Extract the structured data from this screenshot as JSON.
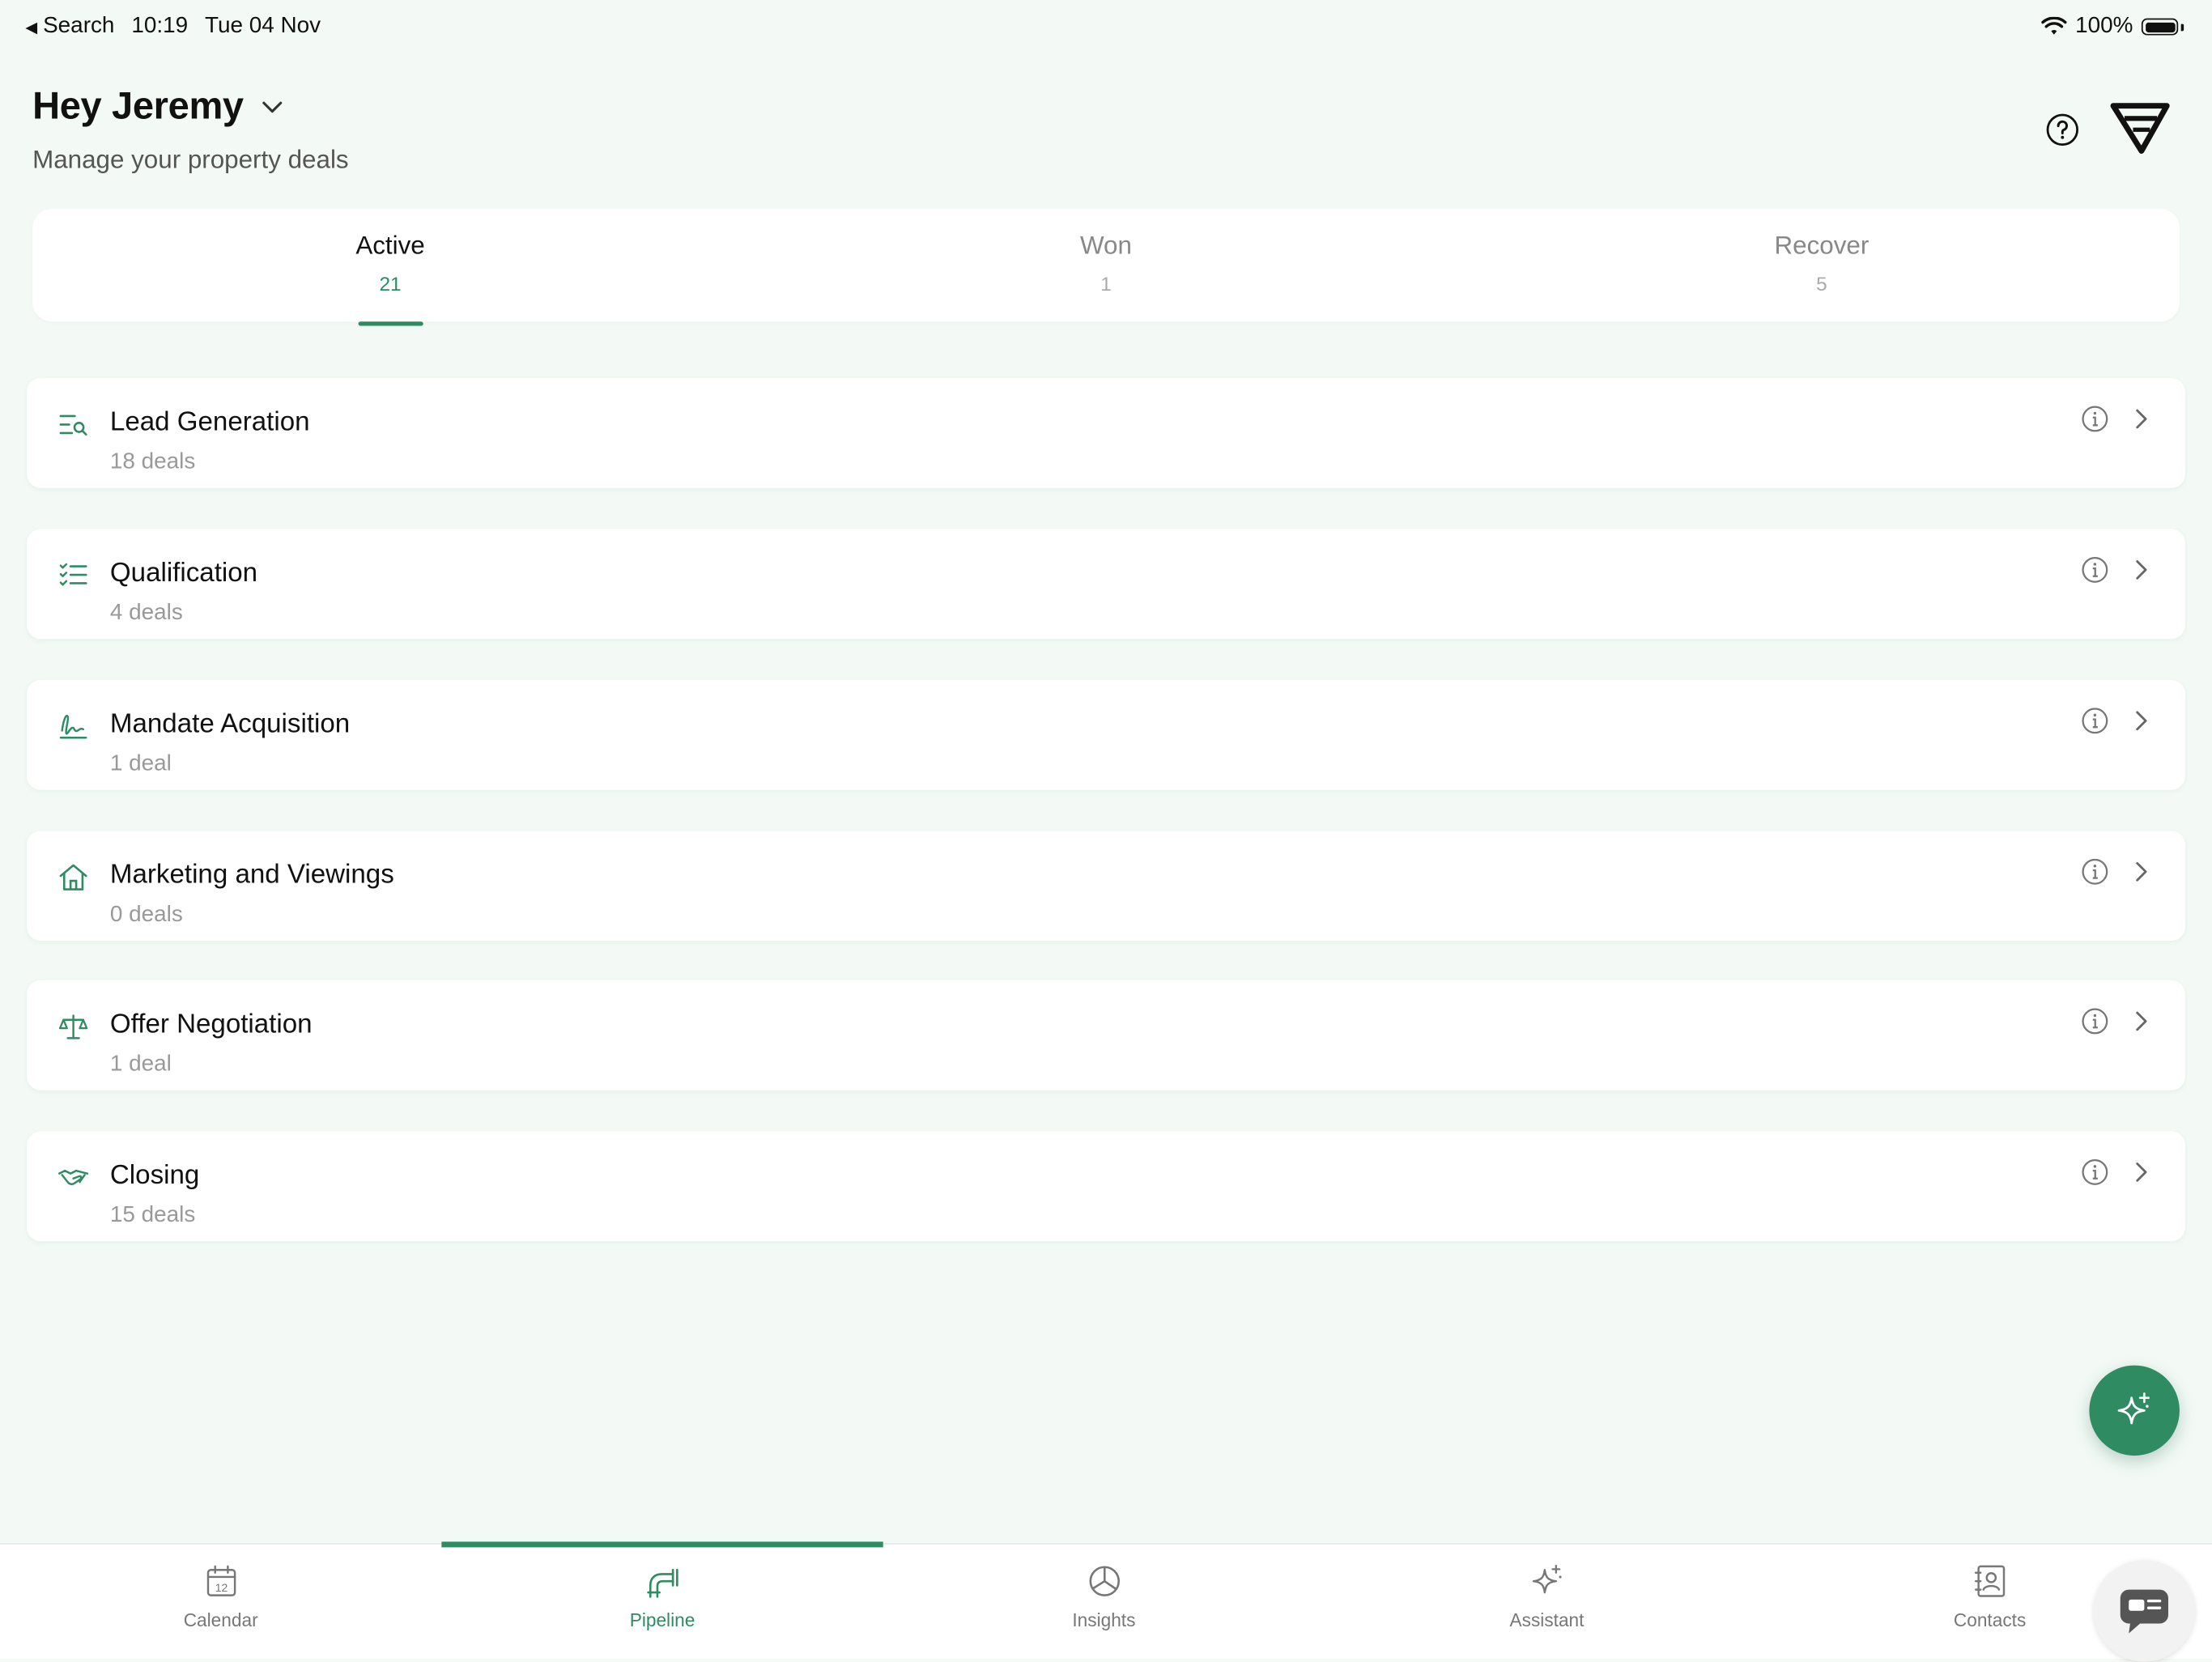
{
  "status_bar": {
    "back_label": "Search",
    "time": "10:19",
    "date": "Tue 04 Nov",
    "battery": "100%"
  },
  "header": {
    "greeting": "Hey Jeremy",
    "subtitle": "Manage your property deals"
  },
  "tabs": [
    {
      "label": "Active",
      "count": "21",
      "active": true
    },
    {
      "label": "Won",
      "count": "1",
      "active": false
    },
    {
      "label": "Recover",
      "count": "5",
      "active": false
    }
  ],
  "stages": [
    {
      "title": "Lead Generation",
      "deals": "18 deals",
      "icon": "search-list-icon"
    },
    {
      "title": "Qualification",
      "deals": "4 deals",
      "icon": "checklist-icon"
    },
    {
      "title": "Mandate Acquisition",
      "deals": "1 deal",
      "icon": "signature-icon"
    },
    {
      "title": "Marketing and Viewings",
      "deals": "0 deals",
      "icon": "house-icon"
    },
    {
      "title": "Offer Negotiation",
      "deals": "1 deal",
      "icon": "scales-icon"
    },
    {
      "title": "Closing",
      "deals": "15 deals",
      "icon": "handshake-icon"
    }
  ],
  "bottom_nav": [
    {
      "label": "Calendar",
      "icon": "calendar-icon",
      "calendar_day": "12"
    },
    {
      "label": "Pipeline",
      "icon": "pipeline-icon",
      "active": true
    },
    {
      "label": "Insights",
      "icon": "pie-chart-icon"
    },
    {
      "label": "Assistant",
      "icon": "sparkle-icon"
    },
    {
      "label": "Contacts",
      "icon": "contacts-icon"
    }
  ],
  "colors": {
    "accent": "#2e8b62",
    "background": "#f3faf6",
    "card": "#ffffff"
  }
}
